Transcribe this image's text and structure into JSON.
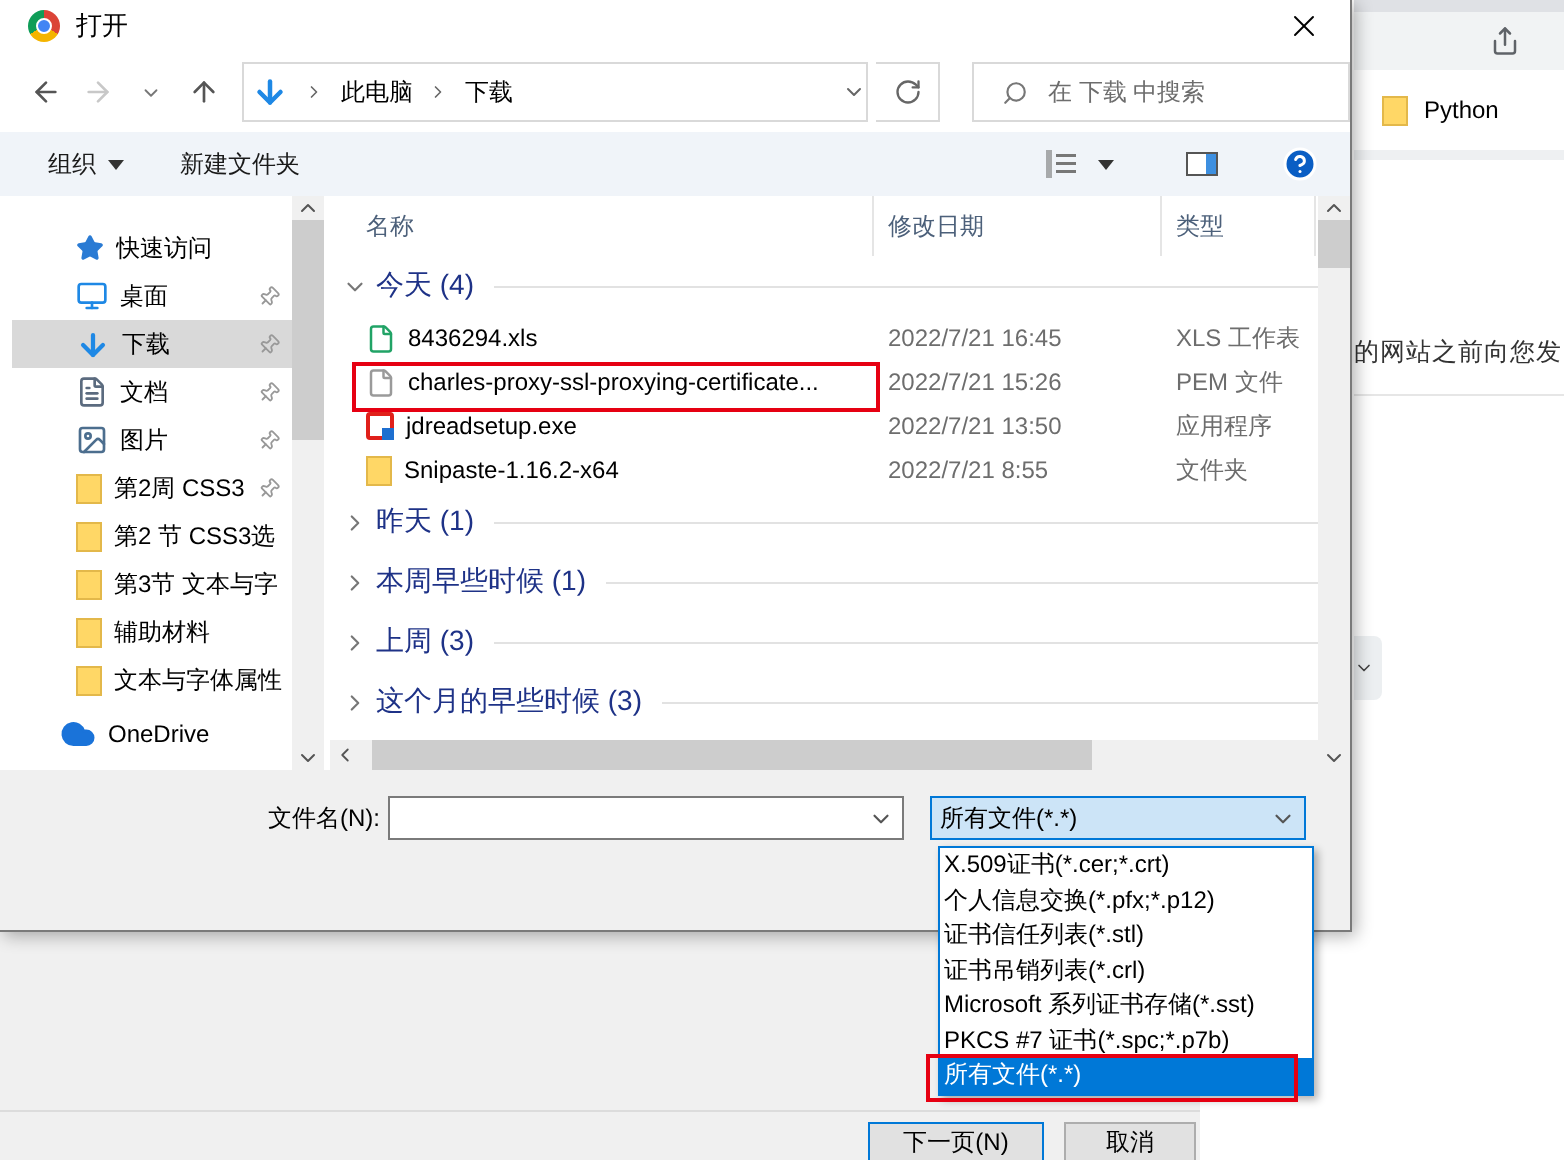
{
  "window": {
    "title": "打开"
  },
  "navigation": {
    "path": [
      "此电脑",
      "下载"
    ],
    "search": {
      "placeholder": "在 下载 中搜索"
    }
  },
  "toolbar": {
    "organize": "组织",
    "new_folder": "新建文件夹"
  },
  "sidebar": {
    "items": [
      {
        "label": "快速访问",
        "kind": "star",
        "pinned": false,
        "selected": false
      },
      {
        "label": "桌面",
        "kind": "desktop",
        "pinned": true,
        "selected": false
      },
      {
        "label": "下载",
        "kind": "download",
        "pinned": true,
        "selected": true
      },
      {
        "label": "文档",
        "kind": "document",
        "pinned": true,
        "selected": false
      },
      {
        "label": "图片",
        "kind": "picture",
        "pinned": true,
        "selected": false
      },
      {
        "label": "第2周 CSS3",
        "kind": "folder",
        "pinned": true,
        "selected": false
      },
      {
        "label": "第2 节 CSS3选",
        "kind": "folder",
        "pinned": false,
        "selected": false
      },
      {
        "label": "第3节 文本与字",
        "kind": "folder",
        "pinned": false,
        "selected": false
      },
      {
        "label": "辅助材料",
        "kind": "folder",
        "pinned": false,
        "selected": false
      },
      {
        "label": "文本与字体属性",
        "kind": "folder",
        "pinned": false,
        "selected": false
      },
      {
        "label": "OneDrive",
        "kind": "cloud",
        "pinned": false,
        "selected": false
      }
    ]
  },
  "file_list": {
    "columns": [
      "名称",
      "修改日期",
      "类型"
    ],
    "groups": [
      {
        "label": "今天 (4)",
        "expanded": true,
        "files": [
          {
            "name": "8436294.xls",
            "modified": "2022/7/21 16:45",
            "type": "XLS 工作表",
            "kind": "xls"
          },
          {
            "name": "charles-proxy-ssl-proxying-certificate...",
            "modified": "2022/7/21 15:26",
            "type": "PEM 文件",
            "kind": "file"
          },
          {
            "name": "jdreadsetup.exe",
            "modified": "2022/7/21 13:50",
            "type": "应用程序",
            "kind": "exe"
          },
          {
            "name": "Snipaste-1.16.2-x64",
            "modified": "2022/7/21 8:55",
            "type": "文件夹",
            "kind": "folder"
          }
        ]
      },
      {
        "label": "昨天 (1)",
        "expanded": false
      },
      {
        "label": "本周早些时候 (1)",
        "expanded": false
      },
      {
        "label": "上周 (3)",
        "expanded": false
      },
      {
        "label": "这个月的早些时候 (3)",
        "expanded": false
      }
    ]
  },
  "file_name": {
    "label": "文件名(N):"
  },
  "file_type": {
    "value": "所有文件(*.*)",
    "options": [
      {
        "label": "X.509证书(*.cer;*.crt)",
        "selected": false
      },
      {
        "label": "个人信息交换(*.pfx;*.p12)",
        "selected": false
      },
      {
        "label": "证书信任列表(*.stl)",
        "selected": false
      },
      {
        "label": "证书吊销列表(*.crl)",
        "selected": false
      },
      {
        "label": "Microsoft 系列证书存储(*.sst)",
        "selected": false
      },
      {
        "label": "PKCS #7 证书(*.spc;*.p7b)",
        "selected": false
      },
      {
        "label": "所有文件(*.*)",
        "selected": true
      }
    ]
  },
  "background": {
    "bookmark": "Python",
    "text": "的网站之前向您发"
  },
  "bottom_buttons": [
    "下一页(N)",
    "取消"
  ]
}
